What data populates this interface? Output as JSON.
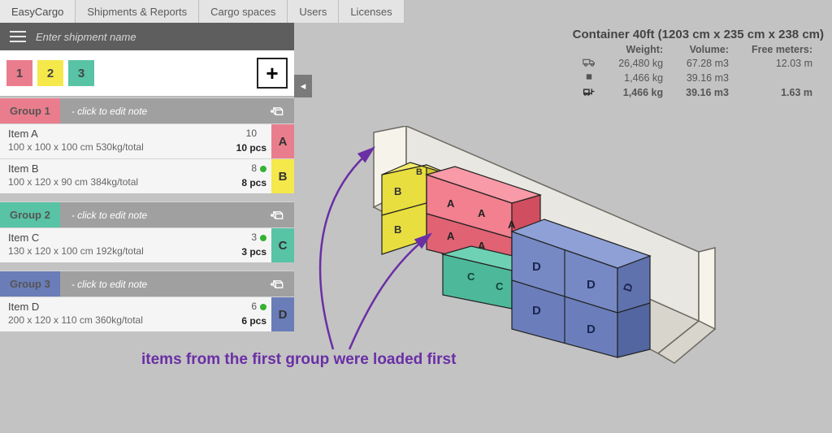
{
  "topnav": {
    "brand": "EasyCargo",
    "tabs": [
      "Shipments & Reports",
      "Cargo spaces",
      "Users",
      "Licenses"
    ]
  },
  "shipment": {
    "placeholder": "Enter shipment name"
  },
  "group_tags": [
    {
      "n": "1",
      "color": "#ea7d8d"
    },
    {
      "n": "2",
      "color": "#f5e84a"
    },
    {
      "n": "3",
      "color": "#58c3a5"
    }
  ],
  "groups": [
    {
      "name": "Group 1",
      "color": "#ea7d8d",
      "note": "- click to edit note",
      "items": [
        {
          "name": "Item A",
          "dims": "100 x 100 x 100 cm 530kg/total",
          "n": "10",
          "pcs": "10 pcs",
          "letter": "A",
          "color": "#ea7d8d",
          "dot": "#34b233"
        },
        {
          "name": "Item B",
          "dims": "100 x 120 x 90 cm 384kg/total",
          "n": "8",
          "pcs": "8 pcs",
          "letter": "B",
          "color": "#f5e84a",
          "dot": "#34b233"
        }
      ]
    },
    {
      "name": "Group 2",
      "color": "#58c3a5",
      "note": "- click to edit note",
      "items": [
        {
          "name": "Item C",
          "dims": "130 x 120 x 100 cm 192kg/total",
          "n": "3",
          "pcs": "3 pcs",
          "letter": "C",
          "color": "#58c3a5",
          "dot": "#34b233"
        }
      ]
    },
    {
      "name": "Group 3",
      "color": "#6a7db8",
      "note": "- click to edit note",
      "items": [
        {
          "name": "Item D",
          "dims": "200 x 120 x 110 cm 360kg/total",
          "n": "6",
          "pcs": "6 pcs",
          "letter": "D",
          "color": "#6a7db8",
          "dot": "#34b233"
        }
      ]
    }
  ],
  "container": {
    "title": "Container 40ft (1203 cm x 235 cm x 238 cm)",
    "cols": [
      "Weight:",
      "Volume:",
      "Free meters:"
    ],
    "rows": [
      {
        "icon": "truck",
        "weight": "26,480 kg",
        "volume": "67.28 m3",
        "free": "12.03 m"
      },
      {
        "icon": "square",
        "weight": "1,466 kg",
        "volume": "39.16 m3",
        "free": ""
      },
      {
        "icon": "forklift",
        "weight": "1,466 kg",
        "volume": "39.16 m3",
        "free": "1.63 m",
        "bold": true
      }
    ]
  },
  "annotation": "items from the first group were loaded first"
}
